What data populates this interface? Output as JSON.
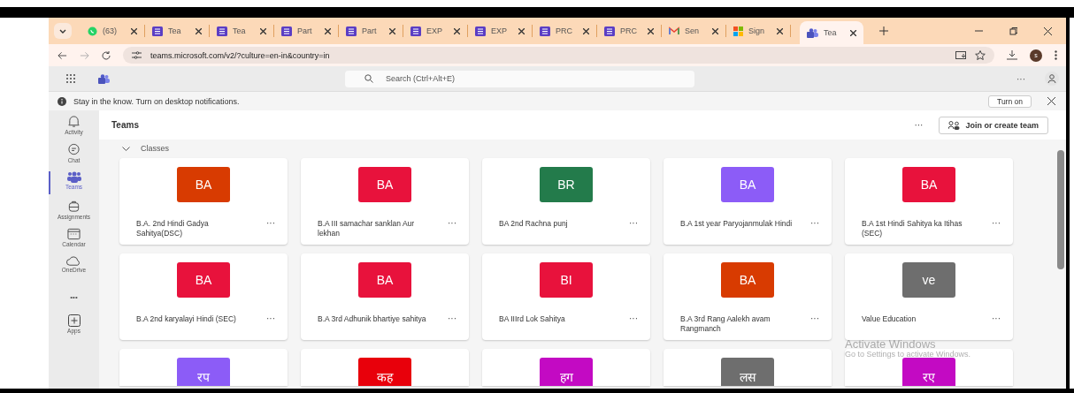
{
  "browser": {
    "tabs": [
      {
        "kind": "whatsapp",
        "label": "(63)",
        "selected": false
      },
      {
        "kind": "forms",
        "label": "Tea",
        "selected": false
      },
      {
        "kind": "forms",
        "label": "Tea",
        "selected": false
      },
      {
        "kind": "forms",
        "label": "Part",
        "selected": false
      },
      {
        "kind": "forms",
        "label": "Part",
        "selected": false
      },
      {
        "kind": "forms",
        "label": "EXP",
        "selected": false
      },
      {
        "kind": "forms",
        "label": "EXP",
        "selected": false
      },
      {
        "kind": "forms",
        "label": "PRC",
        "selected": false
      },
      {
        "kind": "forms",
        "label": "PRC",
        "selected": false
      },
      {
        "kind": "gmail",
        "label": "Sen",
        "selected": false
      },
      {
        "kind": "microsoft",
        "label": "Sign",
        "selected": false
      },
      {
        "kind": "teams",
        "label": "Tea",
        "selected": true
      }
    ],
    "url": "teams.microsoft.com/v2/?culture=en-in&country=in",
    "profile_initial": "s"
  },
  "header": {
    "search_placeholder": "Search (Ctrl+Alt+E)",
    "more": "···"
  },
  "notification": {
    "text": "Stay in the know. Turn on desktop notifications.",
    "button": "Turn on"
  },
  "rail": [
    {
      "kind": "bell",
      "label": "Activity",
      "selected": false
    },
    {
      "kind": "chat",
      "label": "Chat",
      "selected": false
    },
    {
      "kind": "teams",
      "label": "Teams",
      "selected": true
    },
    {
      "kind": "bag",
      "label": "Assignments",
      "selected": false
    },
    {
      "kind": "calendar",
      "label": "Calendar",
      "selected": false
    },
    {
      "kind": "cloud",
      "label": "OneDrive",
      "selected": false
    },
    {
      "kind": "more",
      "label": "•••",
      "selected": false
    },
    {
      "kind": "apps",
      "label": "Apps",
      "selected": false
    }
  ],
  "teams": {
    "title": "Teams",
    "more": "···",
    "join_button": "Join or create team",
    "section": "Classes",
    "cards": [
      {
        "initials": "BA",
        "color": "#d83b01",
        "name": "B.A. 2nd Hindi Gadya Sahitya(DSC)",
        "more": "···"
      },
      {
        "initials": "BA",
        "color": "#e8123c",
        "name": "B.A III samachar sanklan Aur lekhan",
        "more": "···"
      },
      {
        "initials": "BR",
        "color": "#237b4b",
        "name": "BA 2nd Rachna punj",
        "more": "···"
      },
      {
        "initials": "BA",
        "color": "#8c5cf7",
        "name": "B.A 1st year Paryojanmulak Hindi",
        "more": "···"
      },
      {
        "initials": "BA",
        "color": "#e8123c",
        "name": "B.A 1st Hindi Sahitya ka Itihas (SEC)",
        "more": "···"
      },
      {
        "initials": "BA",
        "color": "#e8123c",
        "name": "B.A 2nd karyalayi Hindi (SEC)",
        "more": "···"
      },
      {
        "initials": "BA",
        "color": "#e8123c",
        "name": "B.A 3rd Adhunik bhartiye sahitya",
        "more": "···"
      },
      {
        "initials": "BI",
        "color": "#e8123c",
        "name": "BA IIIrd Lok Sahitya",
        "more": "···"
      },
      {
        "initials": "BA",
        "color": "#d83b01",
        "name": "B.A 3rd Rang Aalekh avam Rangmanch",
        "more": "···"
      },
      {
        "initials": "ve",
        "color": "#6e6e6e",
        "name": "Value Education",
        "more": "···"
      },
      {
        "initials": "रप",
        "color": "#8c5cf7"
      },
      {
        "initials": "कह",
        "color": "#e8000b"
      },
      {
        "initials": "हग",
        "color": "#c30ac3"
      },
      {
        "initials": "लस",
        "color": "#6e6e6e"
      },
      {
        "initials": "रए",
        "color": "#c30ac3"
      }
    ]
  },
  "os_notice": {
    "title": "Activate Windows",
    "text": "Go to Settings to activate Windows."
  }
}
